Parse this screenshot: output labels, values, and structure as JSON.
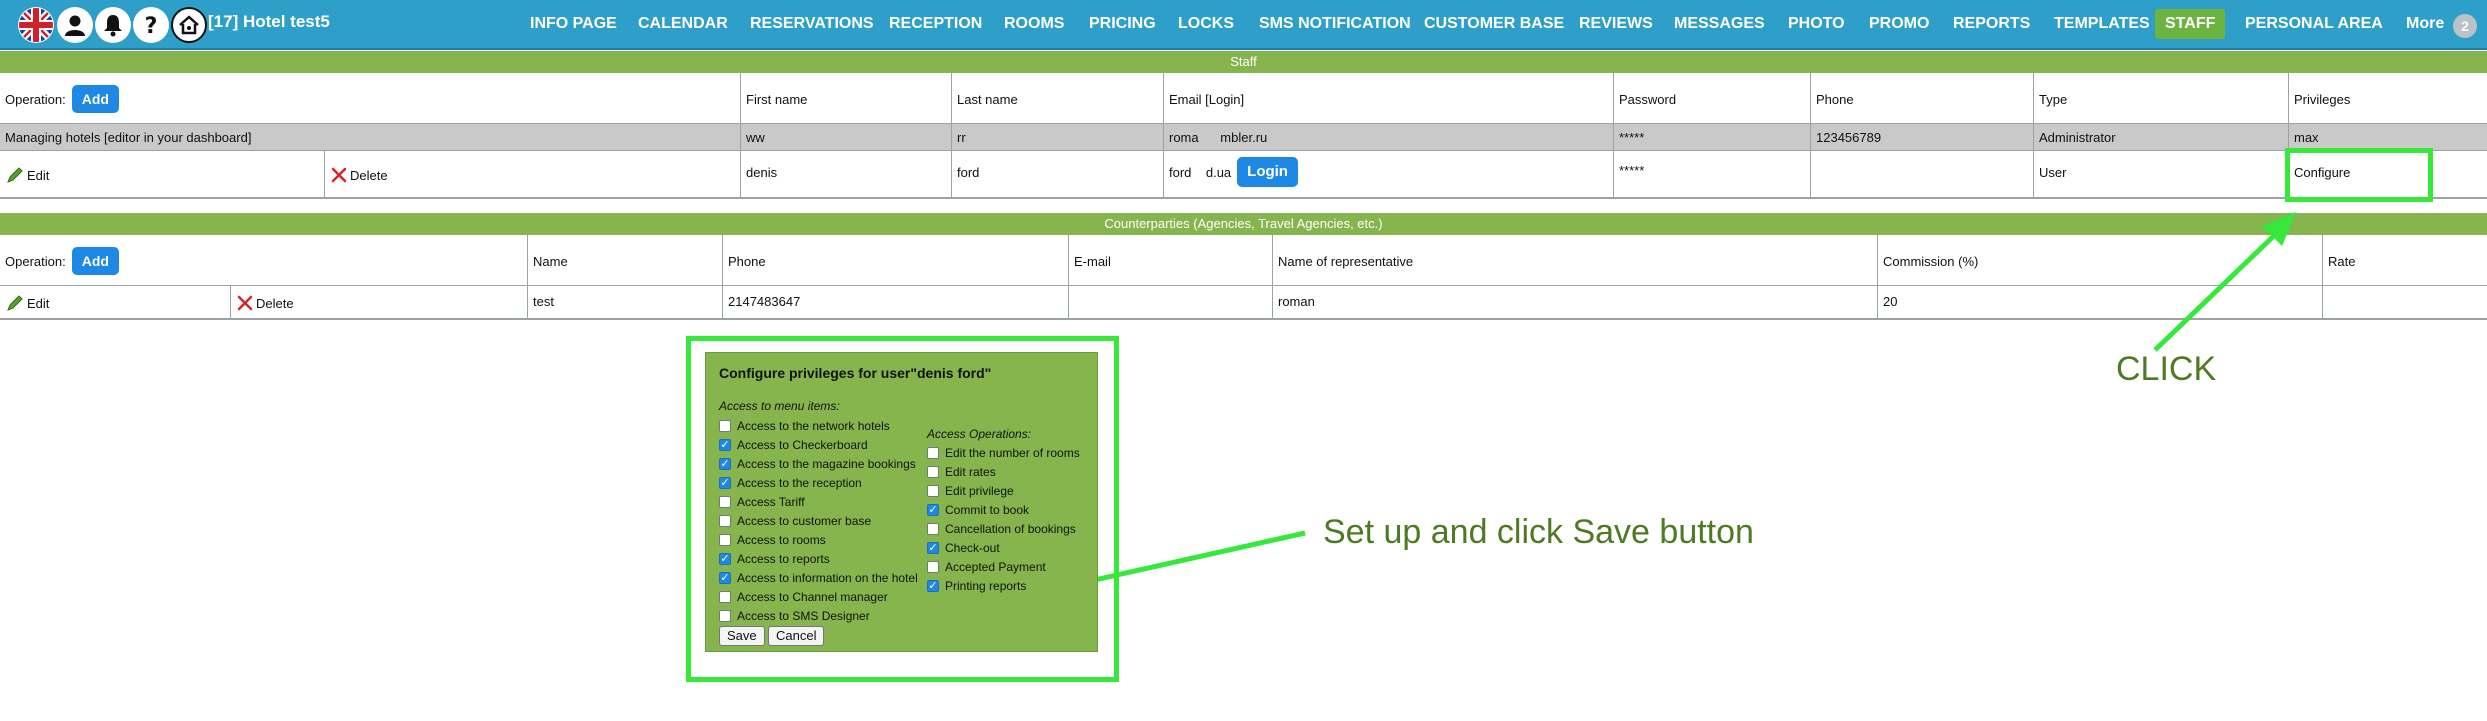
{
  "header": {
    "hotel_name": "[17] Hotel test5",
    "icons": [
      "uk-flag-icon",
      "user-icon",
      "bell-icon",
      "help-icon",
      "home-icon"
    ],
    "nav": [
      {
        "label": "INFO PAGE",
        "active": false
      },
      {
        "label": "CALENDAR",
        "active": false
      },
      {
        "label": "RESERVATIONS",
        "active": false
      },
      {
        "label": "RECEPTION",
        "active": false
      },
      {
        "label": "ROOMS",
        "active": false
      },
      {
        "label": "PRICING",
        "active": false
      },
      {
        "label": "LOCKS",
        "active": false
      },
      {
        "label": "SMS NOTIFICATION",
        "active": false
      },
      {
        "label": "CUSTOMER BASE",
        "active": false
      },
      {
        "label": "REVIEWS",
        "active": false
      },
      {
        "label": "MESSAGES",
        "active": false
      },
      {
        "label": "PHOTO",
        "active": false
      },
      {
        "label": "PROMO",
        "active": false
      },
      {
        "label": "REPORTS",
        "active": false
      },
      {
        "label": "TEMPLATES",
        "active": false
      },
      {
        "label": "STAFF",
        "active": true
      },
      {
        "label": "PERSONAL AREA",
        "active": false
      },
      {
        "label": "More",
        "active": false
      }
    ],
    "badge_count": "2",
    "active_color": "#6db33f",
    "bar_color": "#2e9fc9"
  },
  "staff": {
    "section_title": "Staff",
    "operation_label": "Operation:",
    "add_label": "Add",
    "columns": [
      "First name",
      "Last name",
      "Email [Login]",
      "Password",
      "Phone",
      "Type",
      "Privileges"
    ],
    "managing_row": {
      "label": "Managing hotels [editor in your dashboard]",
      "first_name": "ww",
      "last_name": "rr",
      "email": "roma      mbler.ru",
      "password": "*****",
      "phone": "123456789",
      "type": "Administrator",
      "privileges": "max"
    },
    "user_row": {
      "edit_label": "Edit",
      "delete_label": "Delete",
      "first_name": "denis",
      "last_name": "ford",
      "email": "ford    d.ua",
      "login_label": "Login",
      "password": "*****",
      "phone": "",
      "type": "User",
      "privileges": "Configure"
    }
  },
  "counterparties": {
    "section_title": "Counterparties (Agencies, Travel Agencies, etc.)",
    "operation_label": "Operation:",
    "add_label": "Add",
    "columns": [
      "Name",
      "Phone",
      "E-mail",
      "Name of representative",
      "Commission (%)",
      "Rate"
    ],
    "row": {
      "edit_label": "Edit",
      "delete_label": "Delete",
      "name": "test",
      "phone": "2147483647",
      "email": "",
      "representative": "roman",
      "commission": "20",
      "rate": ""
    }
  },
  "annotations": {
    "click": "CLICK",
    "setup": "Set up and click Save button",
    "highlight_color": "#35e83a"
  },
  "dialog": {
    "title": "Configure privileges for user\"denis ford\"",
    "menu_heading": "Access to menu items:",
    "ops_heading": "Access Operations:",
    "menu_items": [
      {
        "label": "Access to the network hotels",
        "checked": false
      },
      {
        "label": "Access to Checkerboard",
        "checked": true
      },
      {
        "label": "Access to the magazine bookings",
        "checked": true
      },
      {
        "label": "Access to the reception",
        "checked": true
      },
      {
        "label": "Access Tariff",
        "checked": false
      },
      {
        "label": "Access to customer base",
        "checked": false
      },
      {
        "label": "Access to rooms",
        "checked": false
      },
      {
        "label": "Access to reports",
        "checked": true
      },
      {
        "label": "Access to information on the hotel",
        "checked": true
      },
      {
        "label": "Access to Channel manager",
        "checked": false
      },
      {
        "label": "Access to SMS Designer",
        "checked": false
      }
    ],
    "operations": [
      {
        "label": "Edit the number of rooms",
        "checked": false
      },
      {
        "label": "Edit rates",
        "checked": false
      },
      {
        "label": "Edit privilege",
        "checked": false
      },
      {
        "label": "Commit to book",
        "checked": true
      },
      {
        "label": "Cancellation of bookings",
        "checked": false
      },
      {
        "label": "Check-out",
        "checked": true
      },
      {
        "label": "Accepted Payment",
        "checked": false
      },
      {
        "label": "Printing reports",
        "checked": true
      }
    ],
    "save_label": "Save",
    "cancel_label": "Cancel"
  }
}
